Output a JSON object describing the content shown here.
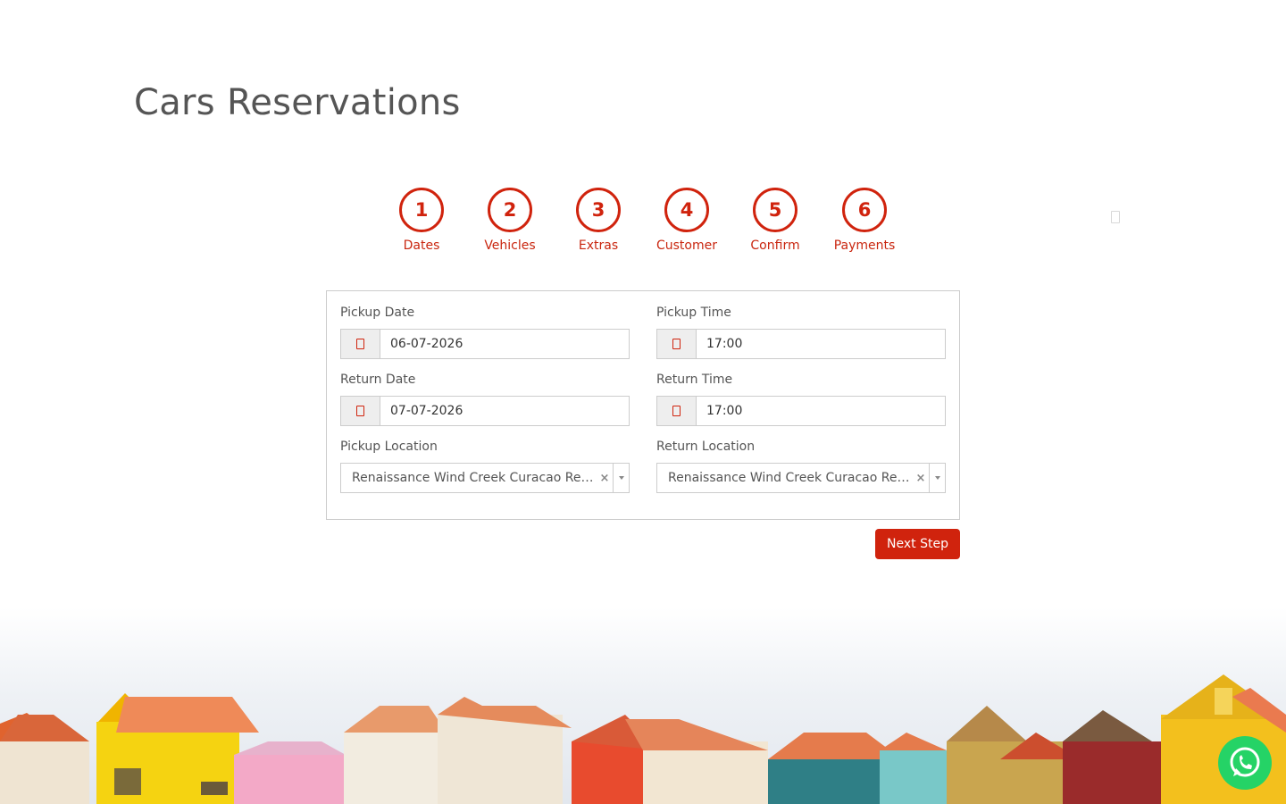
{
  "page": {
    "title": "Cars Reservations"
  },
  "steps": [
    {
      "number": "1",
      "label": "Dates"
    },
    {
      "number": "2",
      "label": "Vehicles"
    },
    {
      "number": "3",
      "label": "Extras"
    },
    {
      "number": "4",
      "label": "Customer"
    },
    {
      "number": "5",
      "label": "Confirm"
    },
    {
      "number": "6",
      "label": "Payments"
    }
  ],
  "form": {
    "pickup_date": {
      "label": "Pickup Date",
      "value": "06-07-2026",
      "icon": "calendar-icon"
    },
    "pickup_time": {
      "label": "Pickup Time",
      "value": "17:00",
      "icon": "clock-icon"
    },
    "return_date": {
      "label": "Return Date",
      "value": "07-07-2026",
      "icon": "calendar-icon"
    },
    "return_time": {
      "label": "Return Time",
      "value": "17:00",
      "icon": "clock-icon"
    },
    "pickup_location": {
      "label": "Pickup Location",
      "value": "Renaissance Wind Creek Curacao Resort",
      "clear": "×"
    },
    "return_location": {
      "label": "Return Location",
      "value": "Renaissance Wind Creek Curacao Resort",
      "clear": "×"
    }
  },
  "actions": {
    "next_label": "Next Step"
  },
  "colors": {
    "accent": "#d0230d",
    "whatsapp": "#25d366"
  },
  "icons": {
    "whatsapp": "whatsapp-icon"
  }
}
